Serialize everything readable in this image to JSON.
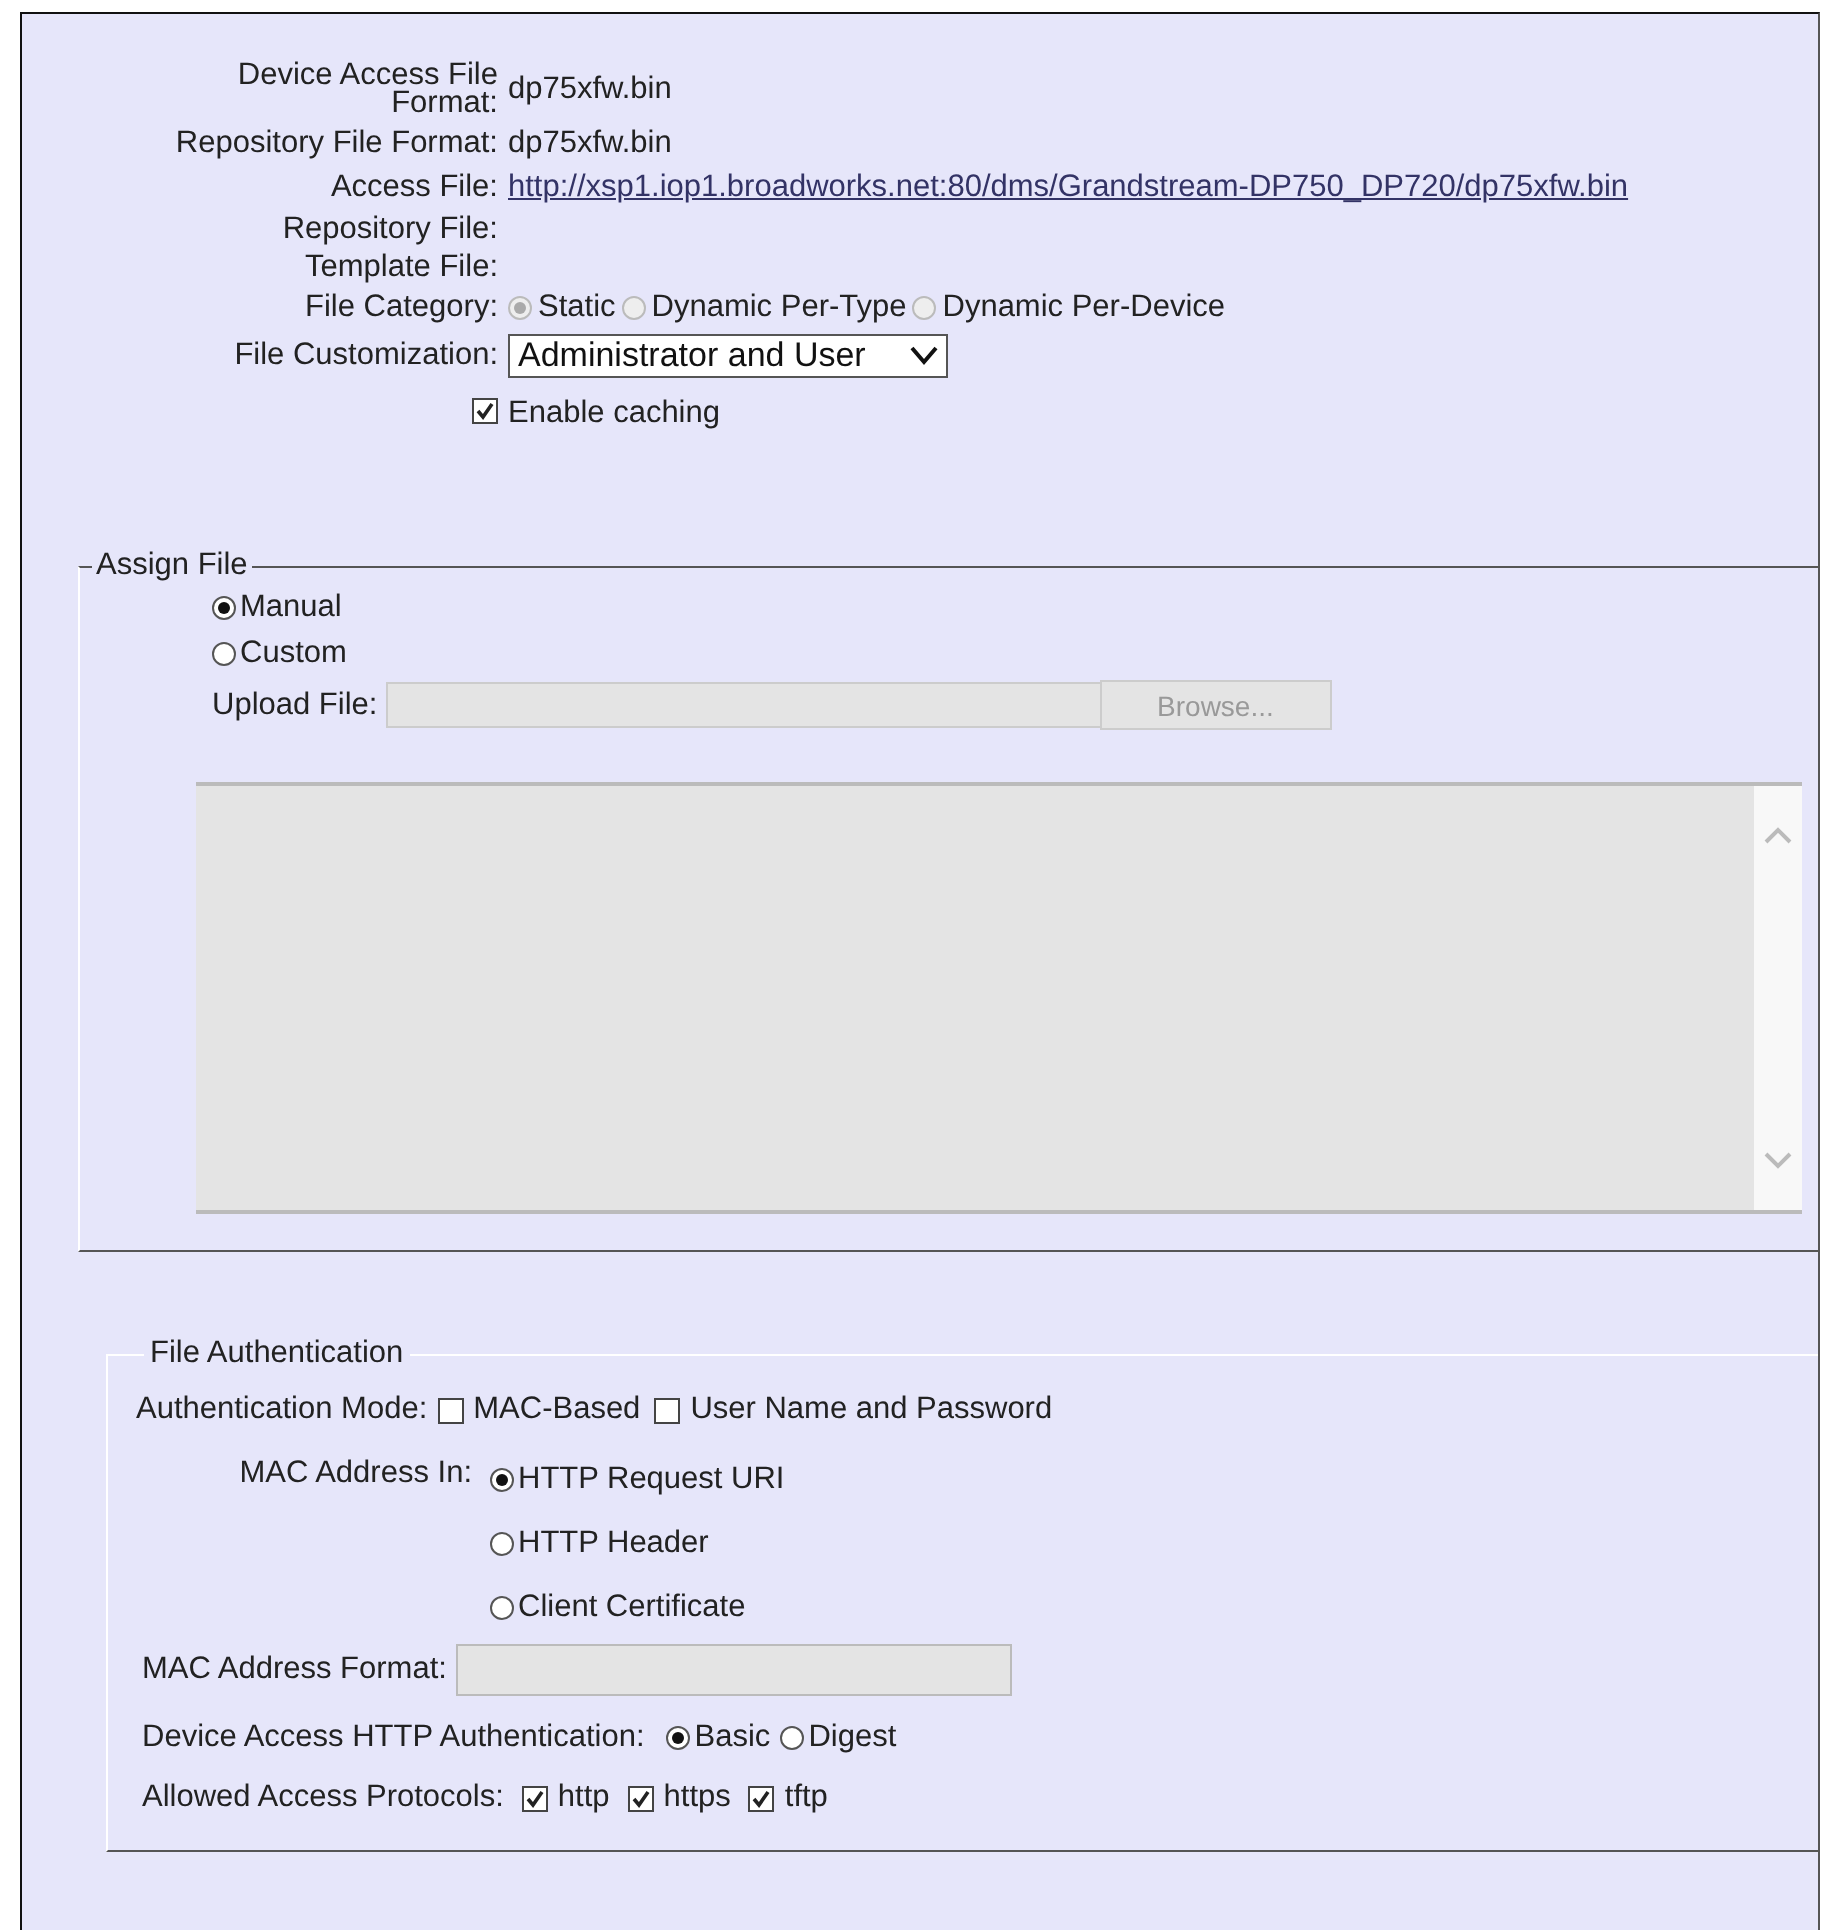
{
  "file_info": [
    {
      "label": "Device Access File Format:",
      "value": "dp75xfw.bin",
      "kind": "text"
    },
    {
      "label": "Repository File Format:",
      "value": "dp75xfw.bin",
      "kind": "text"
    },
    {
      "label": "Access File:",
      "value": "http://xsp1.iop1.broadworks.net:80/dms/Grandstream-DP750_DP720/dp75xfw.bin",
      "kind": "link"
    },
    {
      "label": "Repository File:"
    },
    {
      "label": "Template File:"
    }
  ],
  "file_category": {
    "label": "File Category:",
    "disabled": true,
    "options": [
      {
        "label": "Static",
        "selected": true
      },
      {
        "label": "Dynamic Per-Type",
        "selected": false
      },
      {
        "label": "Dynamic Per-Device",
        "selected": false
      }
    ]
  },
  "file_customization": {
    "label": "File Customization:",
    "value": "Administrator and User"
  },
  "enable_caching": {
    "label": "Enable caching",
    "checked": true
  },
  "assign_file": {
    "legend": "Assign File",
    "options": [
      {
        "label": "Manual",
        "selected": true
      },
      {
        "label": "Custom",
        "selected": false
      }
    ],
    "upload": {
      "label": "Upload File:",
      "button": "Browse...",
      "disabled": true
    }
  },
  "file_authentication": {
    "legend": "File Authentication",
    "mode": {
      "label": "Authentication Mode:",
      "options": [
        {
          "label": "MAC-Based",
          "checked": false
        },
        {
          "label": "User Name and Password",
          "checked": false
        }
      ]
    },
    "mac_address_in": {
      "label": "MAC Address In:",
      "options": [
        {
          "label": "HTTP Request URI",
          "selected": true
        },
        {
          "label": "HTTP Header",
          "selected": false
        },
        {
          "label": "Client Certificate",
          "selected": false
        }
      ]
    },
    "mac_address_format": {
      "label": "MAC Address Format:",
      "disabled": true
    },
    "http_authentication": {
      "label": "Device Access HTTP Authentication:",
      "options": [
        {
          "label": "Basic",
          "selected": true
        },
        {
          "label": "Digest",
          "selected": false
        }
      ]
    },
    "protocols": {
      "label": "Allowed Access Protocols:",
      "options": [
        {
          "label": "http",
          "checked": true
        },
        {
          "label": "https",
          "checked": true
        },
        {
          "label": "tftp",
          "checked": true
        }
      ]
    }
  }
}
